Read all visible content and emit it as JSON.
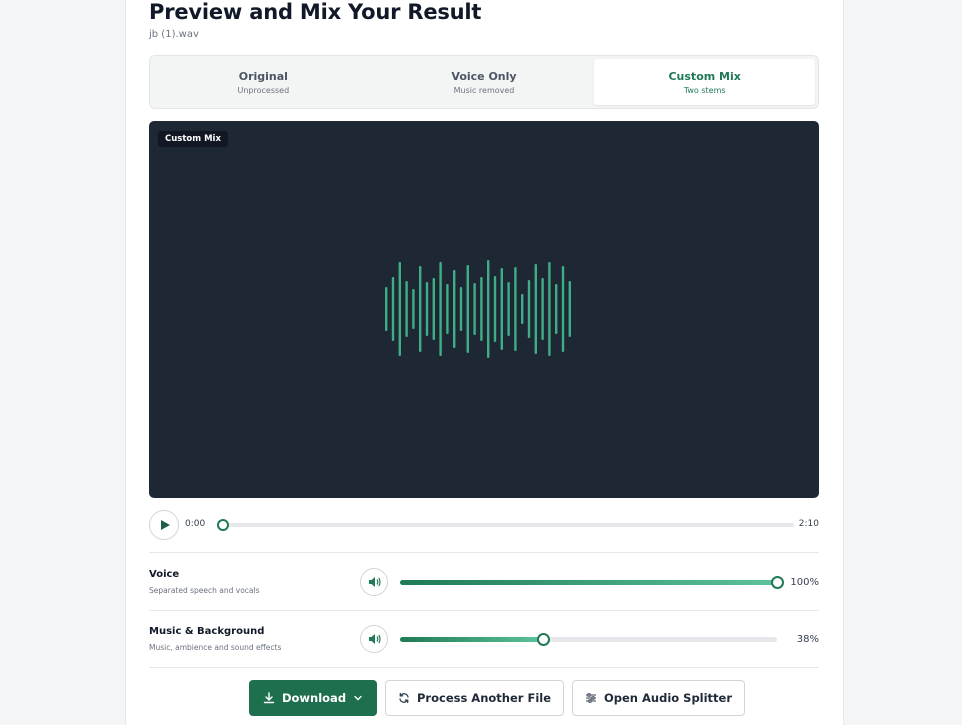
{
  "header": {
    "title": "Preview and Mix Your Result",
    "filename": "jb (1).wav"
  },
  "tabs": [
    {
      "label": "Original",
      "sub": "Unprocessed"
    },
    {
      "label": "Voice Only",
      "sub": "Music removed"
    },
    {
      "label": "Custom Mix",
      "sub": "Two stems"
    }
  ],
  "active_tab": 2,
  "player": {
    "badge": "Custom Mix",
    "current_time": "0:00",
    "duration": "2:10",
    "progress": 0
  },
  "mix": {
    "voice": {
      "label": "Voice",
      "description": "Separated speech and vocals",
      "value_text": "100%",
      "level": 1.0
    },
    "music": {
      "label": "Music & Background",
      "description": "Music, ambience and sound effects",
      "value_text": "38%",
      "level": 0.38
    }
  },
  "actions": {
    "download": "Download",
    "process": "Process Another File",
    "splitter": "Open Audio Splitter"
  },
  "colors": {
    "accent": "#1f7a55",
    "player_bg": "#1e2835",
    "wave": "#3fae85"
  }
}
